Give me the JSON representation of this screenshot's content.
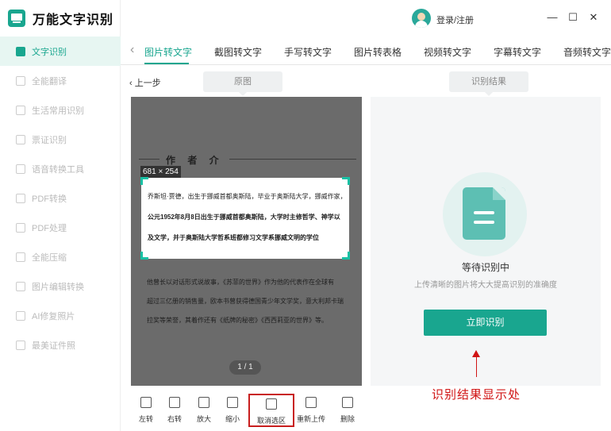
{
  "app": {
    "name": "万能文字识别",
    "login": "登录/注册",
    "win_min": "—",
    "win_max": "☐",
    "win_close": "✕"
  },
  "sidebar": {
    "items": [
      {
        "label": "文字识别",
        "active": true
      },
      {
        "label": "全能翻译"
      },
      {
        "label": "生活常用识别"
      },
      {
        "label": "票证识别"
      },
      {
        "label": "语音转换工具"
      },
      {
        "label": "PDF转换"
      },
      {
        "label": "PDF处理"
      },
      {
        "label": "全能压缩"
      },
      {
        "label": "图片编辑转换"
      },
      {
        "label": "AI修复照片"
      },
      {
        "label": "最美证件照"
      }
    ]
  },
  "tabs": {
    "back": "‹",
    "items": [
      "图片转文字",
      "截图转文字",
      "手写转文字",
      "图片转表格",
      "视频转文字",
      "字幕转文字",
      "音频转文字"
    ]
  },
  "nav": {
    "prev_step": "‹ 上一步"
  },
  "left_panel": {
    "header": "原图",
    "author_title": "作 者 介",
    "dim_label": "681 × 254",
    "selection_lines": [
      "乔斯坦·贾德，出生于挪威首都奥斯陆，毕业于奥斯陆大学，挪威作家，",
      "公元1952年8月8日出生于挪威首都奥斯陆，大学时主修哲学、神学以",
      "及文学，并于奥斯陆大学哲系班都修习文学系挪威文明的学位"
    ],
    "lower_lines": [
      "他曾长以对话形式说故事，《苏菲的世界》作为他的代表作在全球有",
      "超过三亿册的销售量，欧本书曾获得德国青少年文学奖，意大利邦卡瑞",
      "拉奖等荣誉，其着作还有《纸牌的秘密》《西西莉亚的世界》等。"
    ],
    "page_indicator": "1 / 1"
  },
  "right_panel": {
    "header": "识别结果",
    "waiting": "等待识别中",
    "hint": "上传清晰的图片将大大提高识别的准确度",
    "button": "立即识别"
  },
  "annotation": "识别结果显示处",
  "toolbar": {
    "tools": [
      {
        "label": "左转"
      },
      {
        "label": "右转"
      },
      {
        "label": "放大"
      },
      {
        "label": "缩小"
      },
      {
        "label": "取消选区"
      },
      {
        "label": "重新上传"
      },
      {
        "label": "删除"
      }
    ]
  },
  "colors": {
    "accent": "#19a68f",
    "annotation": "#d01414"
  }
}
